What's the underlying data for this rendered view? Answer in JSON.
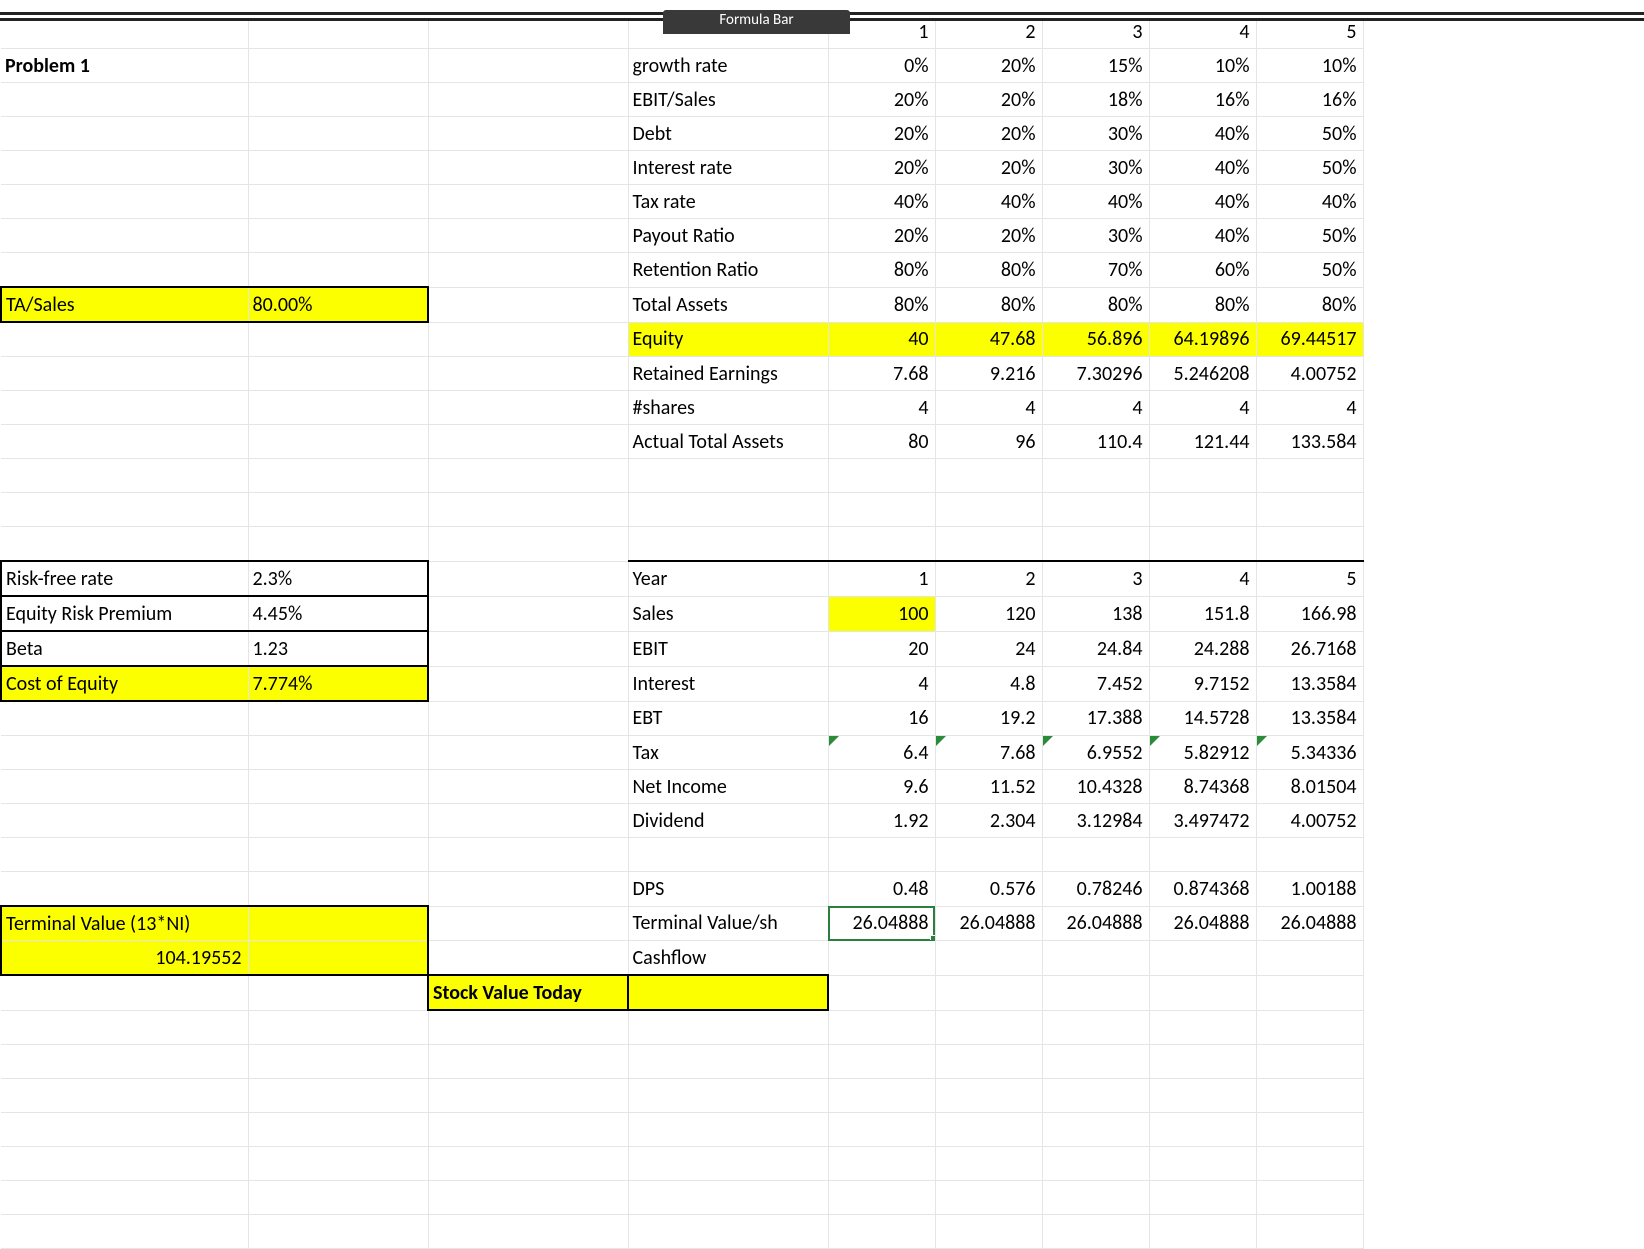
{
  "ui": {
    "formula_bar_label": "Formula Bar"
  },
  "left": {
    "problem_title": "Problem 1",
    "ta_sales_label": "TA/Sales",
    "ta_sales_value": "80.00%",
    "risk_free_label": "Risk-free rate",
    "risk_free_value": "2.3%",
    "erp_label": "Equity Risk Premium",
    "erp_value": "4.45%",
    "beta_label": "Beta",
    "beta_value": "1.23",
    "coe_label": "Cost of Equity",
    "coe_value": "7.774%",
    "terminal_label": "Terminal Value (13*NI)",
    "terminal_value": "104.19552",
    "stock_value_label": "Stock Value Today"
  },
  "top_table": {
    "headers": [
      "1",
      "2",
      "3",
      "4",
      "5"
    ],
    "rows": [
      {
        "label": "growth rate",
        "vals": [
          "0%",
          "20%",
          "15%",
          "10%",
          "10%"
        ]
      },
      {
        "label": "EBIT/Sales",
        "vals": [
          "20%",
          "20%",
          "18%",
          "16%",
          "16%"
        ]
      },
      {
        "label": "Debt",
        "vals": [
          "20%",
          "20%",
          "30%",
          "40%",
          "50%"
        ]
      },
      {
        "label": "Interest rate",
        "vals": [
          "20%",
          "20%",
          "30%",
          "40%",
          "50%"
        ]
      },
      {
        "label": "Tax rate",
        "vals": [
          "40%",
          "40%",
          "40%",
          "40%",
          "40%"
        ]
      },
      {
        "label": "Payout Ratio",
        "vals": [
          "20%",
          "20%",
          "30%",
          "40%",
          "50%"
        ]
      },
      {
        "label": "Retention Ratio",
        "vals": [
          "80%",
          "80%",
          "70%",
          "60%",
          "50%"
        ]
      },
      {
        "label": "Total Assets",
        "vals": [
          "80%",
          "80%",
          "80%",
          "80%",
          "80%"
        ]
      },
      {
        "label": "Equity",
        "vals": [
          "40",
          "47.68",
          "56.896",
          "64.19896",
          "69.44517"
        ]
      },
      {
        "label": "Retained Earnings",
        "vals": [
          "7.68",
          "9.216",
          "7.30296",
          "5.246208",
          "4.00752"
        ]
      },
      {
        "label": "#shares",
        "vals": [
          "4",
          "4",
          "4",
          "4",
          "4"
        ]
      },
      {
        "label": "Actual Total Assets",
        "vals": [
          "80",
          "96",
          "110.4",
          "121.44",
          "133.584"
        ]
      }
    ]
  },
  "bottom_table": {
    "rows": [
      {
        "label": "Year",
        "vals": [
          "1",
          "2",
          "3",
          "4",
          "5"
        ]
      },
      {
        "label": "Sales",
        "vals": [
          "100",
          "120",
          "138",
          "151.8",
          "166.98"
        ]
      },
      {
        "label": "EBIT",
        "vals": [
          "20",
          "24",
          "24.84",
          "24.288",
          "26.7168"
        ]
      },
      {
        "label": "Interest",
        "vals": [
          "4",
          "4.8",
          "7.452",
          "9.7152",
          "13.3584"
        ]
      },
      {
        "label": "EBT",
        "vals": [
          "16",
          "19.2",
          "17.388",
          "14.5728",
          "13.3584"
        ]
      },
      {
        "label": "Tax",
        "vals": [
          "6.4",
          "7.68",
          "6.9552",
          "5.82912",
          "5.34336"
        ]
      },
      {
        "label": "Net Income",
        "vals": [
          "9.6",
          "11.52",
          "10.4328",
          "8.74368",
          "8.01504"
        ]
      },
      {
        "label": "Dividend",
        "vals": [
          "1.92",
          "2.304",
          "3.12984",
          "3.497472",
          "4.00752"
        ]
      }
    ],
    "dps_label": "DPS",
    "dps": [
      "0.48",
      "0.576",
      "0.78246",
      "0.874368",
      "1.00188"
    ],
    "tvsh_label": "Terminal Value/sh",
    "tvsh": [
      "26.04888",
      "26.04888",
      "26.04888",
      "26.04888",
      "26.04888"
    ],
    "cashflow_label": "Cashflow"
  }
}
